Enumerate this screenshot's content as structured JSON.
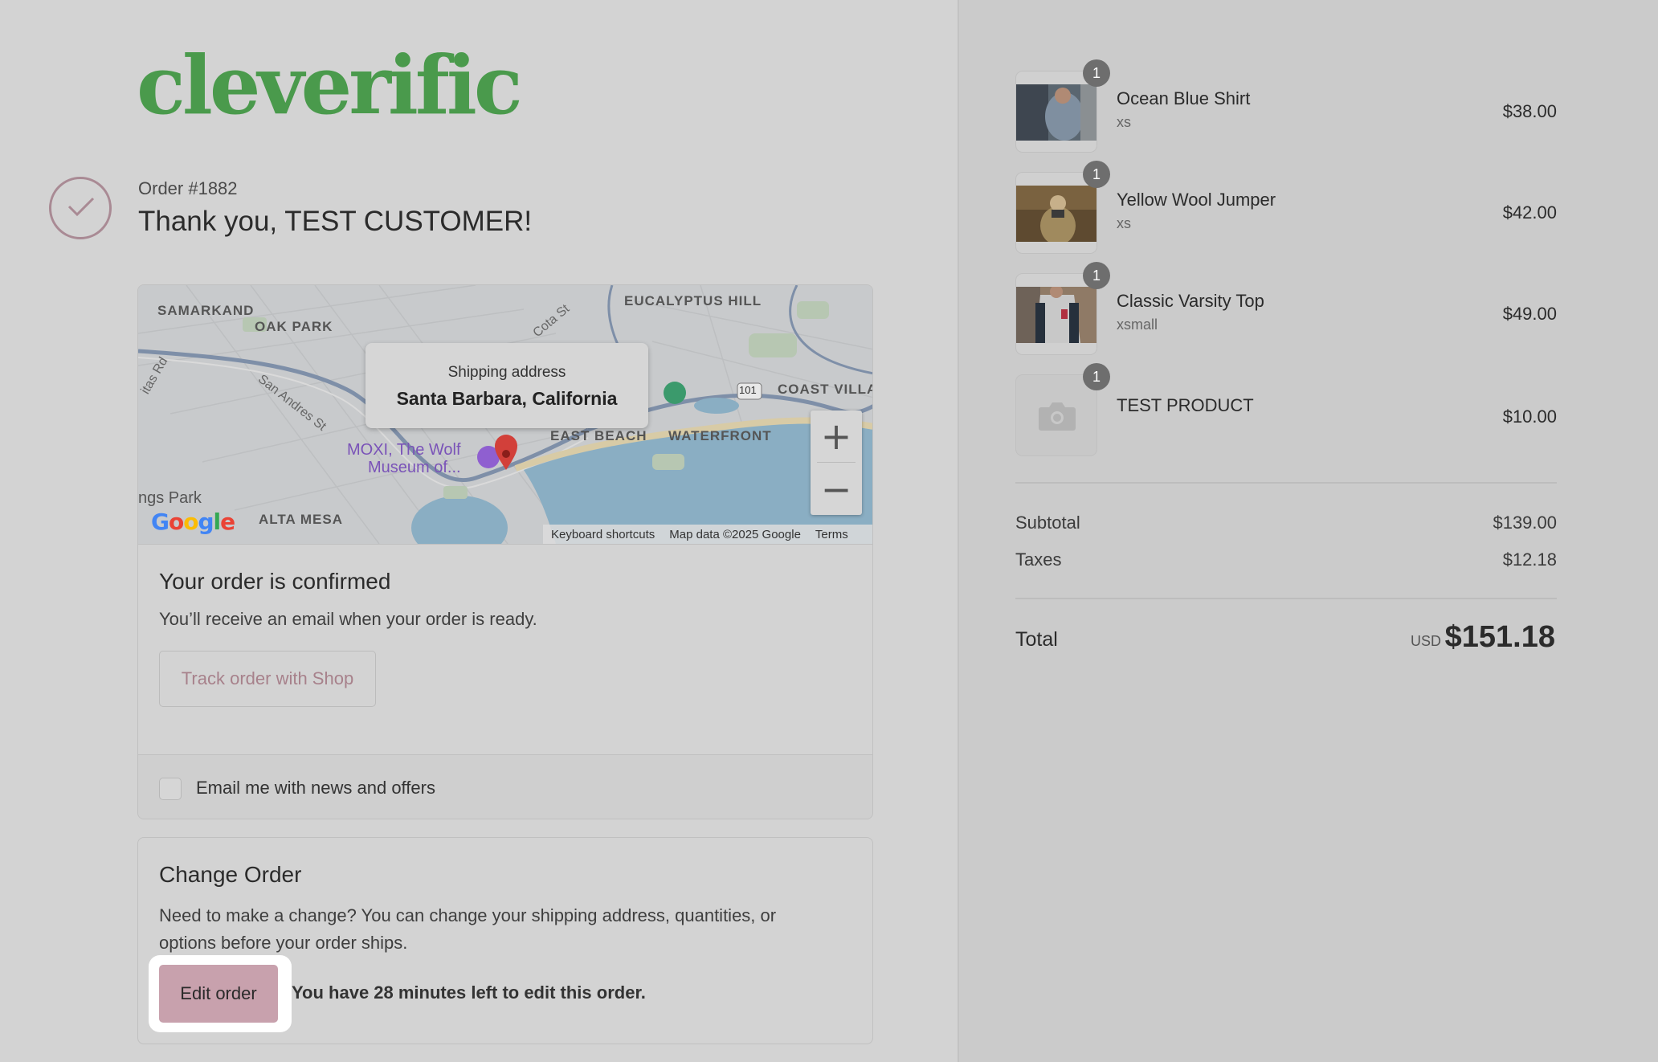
{
  "brand": {
    "logo_text": "cleverific",
    "accent": "#4a9a4c"
  },
  "order": {
    "number": "Order #1882",
    "thank_you": "Thank you, TEST CUSTOMER!"
  },
  "map": {
    "popup_title": "Shipping address",
    "popup_address": "Santa Barbara, California",
    "labels": {
      "samarkand": "SAMARKAND",
      "oak_park": "OAK PARK",
      "eucalyptus_hill": "EUCALYPTUS HILL",
      "coast_village": "COAST VILLA",
      "east_beach": "EAST BEACH",
      "waterfront": "WATERFRONT",
      "alta_mesa": "ALTA MESA",
      "ngs_park": "ngs Park",
      "moxi_1": "MOXI, The Wolf",
      "moxi_2": "Museum of...",
      "san_andres": "San Andres St",
      "cota_st": "Cota St",
      "las_positas": "itas Rd",
      "route_101": "101"
    },
    "zoom_in": "+",
    "zoom_out": "−",
    "google": "Google",
    "attribution": {
      "shortcuts": "Keyboard shortcuts",
      "data": "Map data ©2025 Google",
      "terms": "Terms"
    }
  },
  "confirmed": {
    "title": "Your order is confirmed",
    "text": "You’ll receive an email when your order is ready.",
    "track_button": "Track order with Shop"
  },
  "newsletter": {
    "label": "Email me with news and offers"
  },
  "change_order": {
    "title": "Change Order",
    "text": "Need to make a change? You can change your shipping address, quantities, or options before your order ships.",
    "edit_button": "Edit order",
    "time_left": "You have 28 minutes left to edit this order."
  },
  "items": [
    {
      "qty": "1",
      "name": "Ocean Blue Shirt",
      "variant": "xs",
      "price": "$38.00"
    },
    {
      "qty": "1",
      "name": "Yellow Wool Jumper",
      "variant": "xs",
      "price": "$42.00"
    },
    {
      "qty": "1",
      "name": "Classic Varsity Top",
      "variant": "xsmall",
      "price": "$49.00"
    },
    {
      "qty": "1",
      "name": "TEST PRODUCT",
      "variant": "",
      "price": "$10.00"
    }
  ],
  "summary": {
    "subtotal_label": "Subtotal",
    "subtotal": "$139.00",
    "taxes_label": "Taxes",
    "taxes": "$12.18",
    "total_label": "Total",
    "currency": "USD",
    "total": "$151.18"
  }
}
